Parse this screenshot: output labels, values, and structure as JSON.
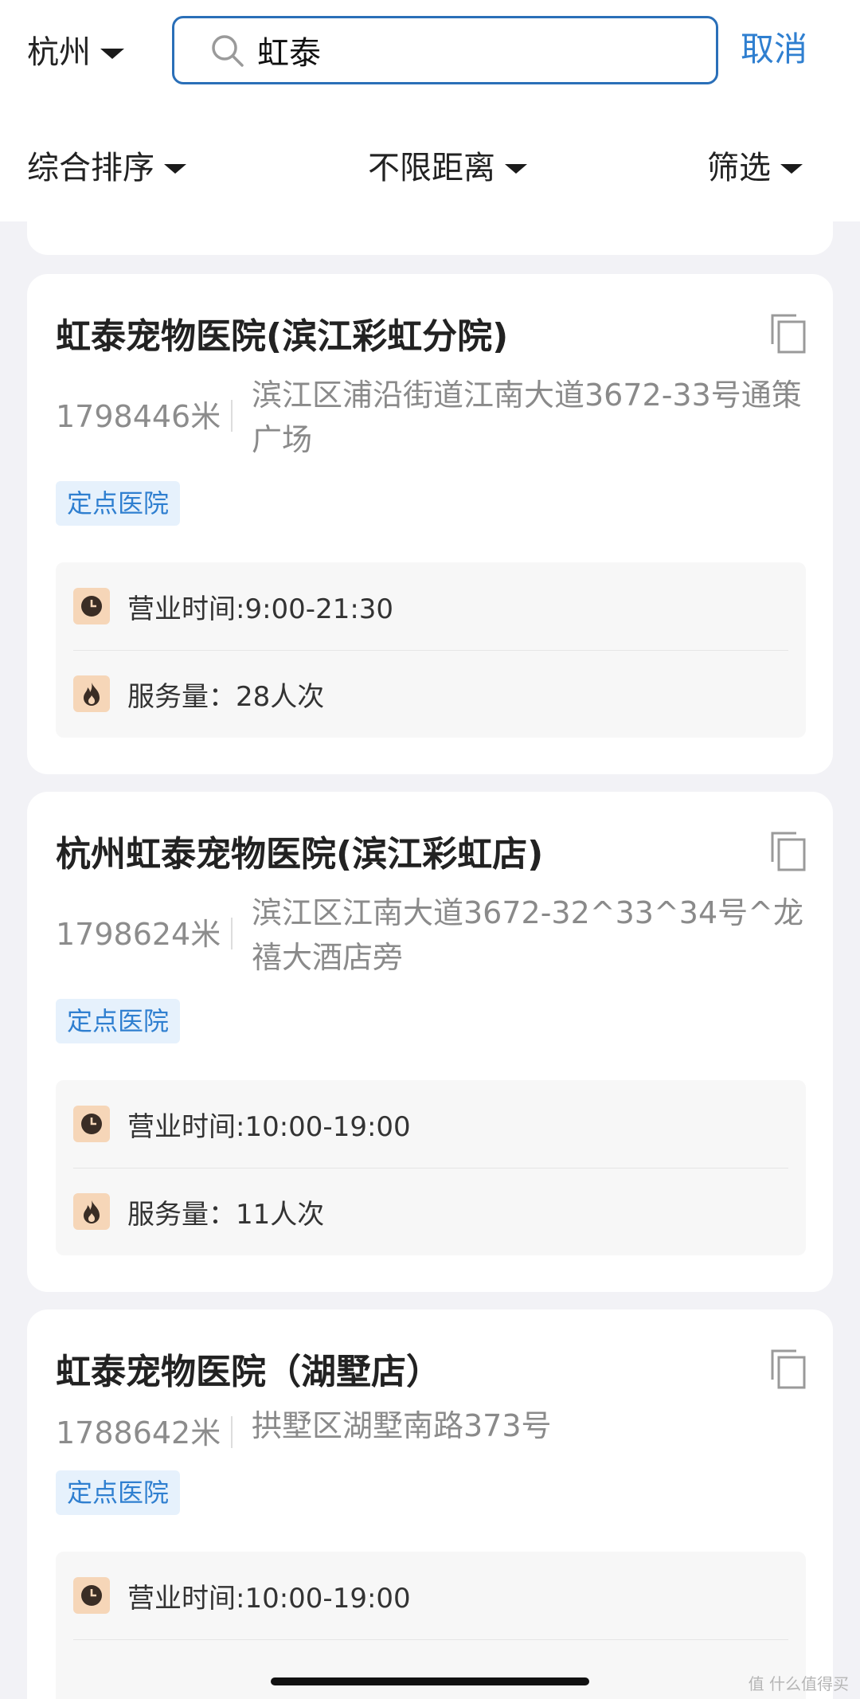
{
  "header": {
    "city": "杭州",
    "search_value": "虹泰",
    "cancel_label": "取消"
  },
  "filters": {
    "sort_label": "综合排序",
    "distance_label": "不限距离",
    "filter_label": "筛选"
  },
  "results": [
    {
      "name": "虹泰宠物医院(滨江彩虹分院)",
      "distance": "1798446米",
      "address": "滨江区浦沿街道江南大道3672-33号通策广场",
      "tag": "定点医院",
      "hours": "营业时间:9:00-21:30",
      "service_count": "服务量：28人次"
    },
    {
      "name": "杭州虹泰宠物医院(滨江彩虹店)",
      "distance": "1798624米",
      "address": "滨江区江南大道3672-32^33^34号^龙禧大酒店旁",
      "tag": "定点医院",
      "hours": "营业时间:10:00-19:00",
      "service_count": "服务量：11人次"
    },
    {
      "name": "虹泰宠物医院（湖墅店）",
      "distance": "1788642米",
      "address": "拱墅区湖墅南路373号",
      "tag": "定点医院",
      "hours": "营业时间:10:00-19:00"
    }
  ],
  "watermark": "值 什么值得买",
  "colors": {
    "accent": "#2f7fd0",
    "tag_bg": "#e6f1fc",
    "icon_badge_bg": "#f6d6b8",
    "page_bg": "#f2f2f6"
  }
}
